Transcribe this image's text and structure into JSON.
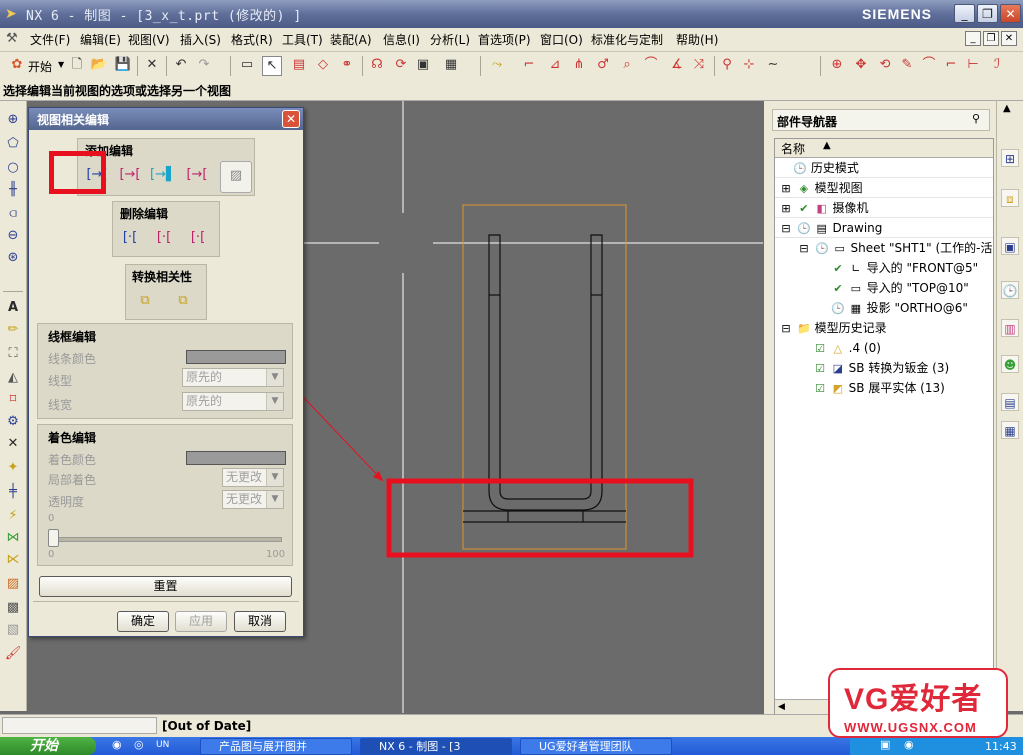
{
  "window": {
    "title": "NX 6 - 制图 - [3_x_t.prt  (修改的) ]",
    "brand": "SIEMENS",
    "minimize": "_",
    "restore": "❐",
    "close": "✕"
  },
  "menubar": {
    "items": [
      "文件(F)",
      "编辑(E)",
      "视图(V)",
      "插入(S)",
      "格式(R)",
      "工具(T)",
      "装配(A)",
      "信息(I)",
      "分析(L)",
      "首选项(P)",
      "窗口(O)",
      "标准化与定制",
      "帮助(H)"
    ]
  },
  "toolbar": {
    "start_label": "开始"
  },
  "cue_line": "选择编辑当前视图的选项或选择另一个视图",
  "dialog": {
    "title": "视图相关编辑",
    "add_edit": {
      "label": "添加编辑"
    },
    "delete_edit": {
      "label": "删除编辑"
    },
    "convert": {
      "label": "转换相关性"
    },
    "wireframe": {
      "label": "线框编辑",
      "line_color": "线条颜色",
      "line_type": "线型",
      "line_type_value": "原先的",
      "line_width": "线宽",
      "line_width_value": "原先的"
    },
    "shading": {
      "label": "着色编辑",
      "shade_color": "着色颜色",
      "partial_shade": "局部着色",
      "partial_shade_value": "无更改",
      "transparency": "透明度",
      "transparency_value": "无更改",
      "slider_value": "0",
      "slider_min": "0",
      "slider_max": "100",
      "slider_level": 0
    },
    "reset": "重置",
    "ok": "确定",
    "apply": "应用",
    "cancel": "取消"
  },
  "navigator": {
    "title": "部件导航器",
    "column": "名称",
    "nodes": [
      "历史模式",
      "模型视图",
      "摄像机",
      "Drawing",
      "Sheet \"SHT1\" (工作的-活动",
      "导入的 \"FRONT@5\"",
      "导入的 \"TOP@10\"",
      "投影 \"ORTHO@6\"",
      "模型历史记录",
      ".4 (0)",
      "SB 转换为钣金 (3)",
      "SB 展平实体 (13)"
    ]
  },
  "statusbar": {
    "text": "[Out of Date]"
  },
  "taskbar": {
    "start": "开始",
    "tasks": [
      "UN",
      "产品图与展开图并",
      "NX 6 - 制图 - [3",
      "UG爱好者管理团队"
    ],
    "time": "11:43"
  },
  "watermark": {
    "text": "VG爱好者",
    "url": "WWW.UGSNX.COM"
  },
  "colors": {
    "highlight_red": "#e8101e",
    "view_border": "#e0952e",
    "title_blue": "#5f6f9a"
  }
}
